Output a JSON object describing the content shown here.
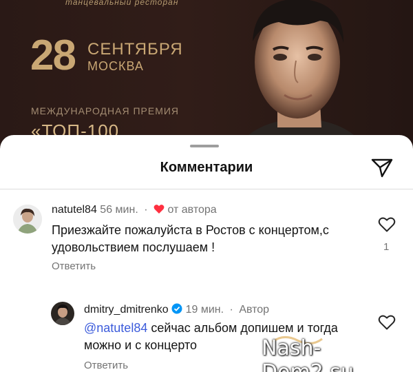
{
  "poster": {
    "venue": "танцевальный ресторан",
    "day": "28",
    "month": "СЕНТЯБРЯ",
    "city": "МОСКВА",
    "award": "МЕЖДУНАРОДНАЯ ПРЕМИЯ",
    "top": "«ТОП-100"
  },
  "sheet": {
    "title": "Комментарии"
  },
  "comments": [
    {
      "username": "natutel84",
      "time": "56 мин.",
      "badge": "от автора",
      "text": "Приезжайте пожалуйста в Ростов с концертом,с удовольствием послушаем !",
      "reply_label": "Ответить",
      "likes": "1"
    },
    {
      "username": "dmitry_dmitrenko",
      "time": "19 мин.",
      "author_label": "Автор",
      "mention": "@natutel84",
      "text": " сейчас альбом допишем и тогда можно и с концерто",
      "reply_label": "Ответить"
    }
  ],
  "watermark": "Nash-Dom2.su",
  "colors": {
    "accent_blue": "#3b5bdb",
    "verified_blue": "#0095f6",
    "heart_red": "#ff3040",
    "poster_gold": "#c9a774"
  },
  "icons": [
    "share-icon",
    "heart-outline-icon",
    "verified-icon",
    "red-heart-icon"
  ]
}
